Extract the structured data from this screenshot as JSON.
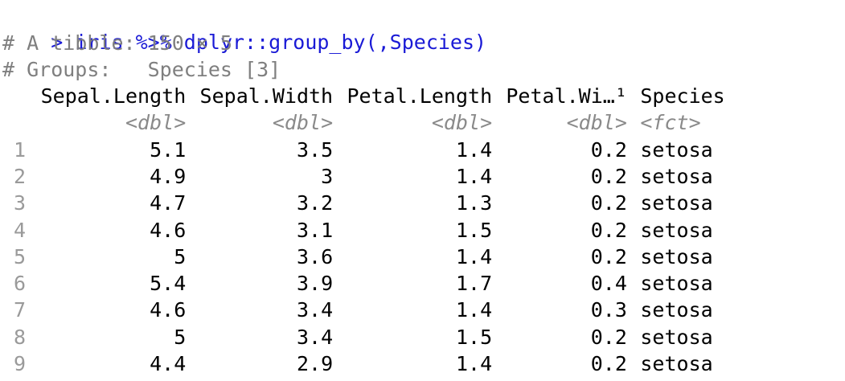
{
  "console": {
    "prompt": ">",
    "command": "iris %>% dplyr::group_by(,Species)",
    "meta_lines": [
      "# A tibble: 150 × 5",
      "# Groups:   Species [3]"
    ],
    "columns": [
      {
        "name": "Sepal.Length",
        "type": "<dbl>"
      },
      {
        "name": "Sepal.Width",
        "type": "<dbl>"
      },
      {
        "name": "Petal.Length",
        "type": "<dbl>"
      },
      {
        "name": "Petal.Wi…¹",
        "type": "<dbl>"
      },
      {
        "name": "Species",
        "type": "<fct>"
      }
    ],
    "rows": [
      {
        "n": "1",
        "cells": [
          "5.1",
          "3.5",
          "1.4",
          "0.2",
          "setosa"
        ]
      },
      {
        "n": "2",
        "cells": [
          "4.9",
          "3",
          "1.4",
          "0.2",
          "setosa"
        ]
      },
      {
        "n": "3",
        "cells": [
          "4.7",
          "3.2",
          "1.3",
          "0.2",
          "setosa"
        ]
      },
      {
        "n": "4",
        "cells": [
          "4.6",
          "3.1",
          "1.5",
          "0.2",
          "setosa"
        ]
      },
      {
        "n": "5",
        "cells": [
          "5",
          "3.6",
          "1.4",
          "0.2",
          "setosa"
        ]
      },
      {
        "n": "6",
        "cells": [
          "5.4",
          "3.9",
          "1.7",
          "0.4",
          "setosa"
        ]
      },
      {
        "n": "7",
        "cells": [
          "4.6",
          "3.4",
          "1.4",
          "0.3",
          "setosa"
        ]
      },
      {
        "n": "8",
        "cells": [
          "5",
          "3.4",
          "1.5",
          "0.2",
          "setosa"
        ]
      },
      {
        "n": "9",
        "cells": [
          "4.4",
          "2.9",
          "1.4",
          "0.2",
          "setosa"
        ]
      }
    ],
    "colors": {
      "command": "#1a1ad6",
      "comment": "#7f7f7f",
      "type": "#8a8a8a",
      "row_number": "#9a9a9a",
      "error_clip": "#c0201f"
    }
  }
}
